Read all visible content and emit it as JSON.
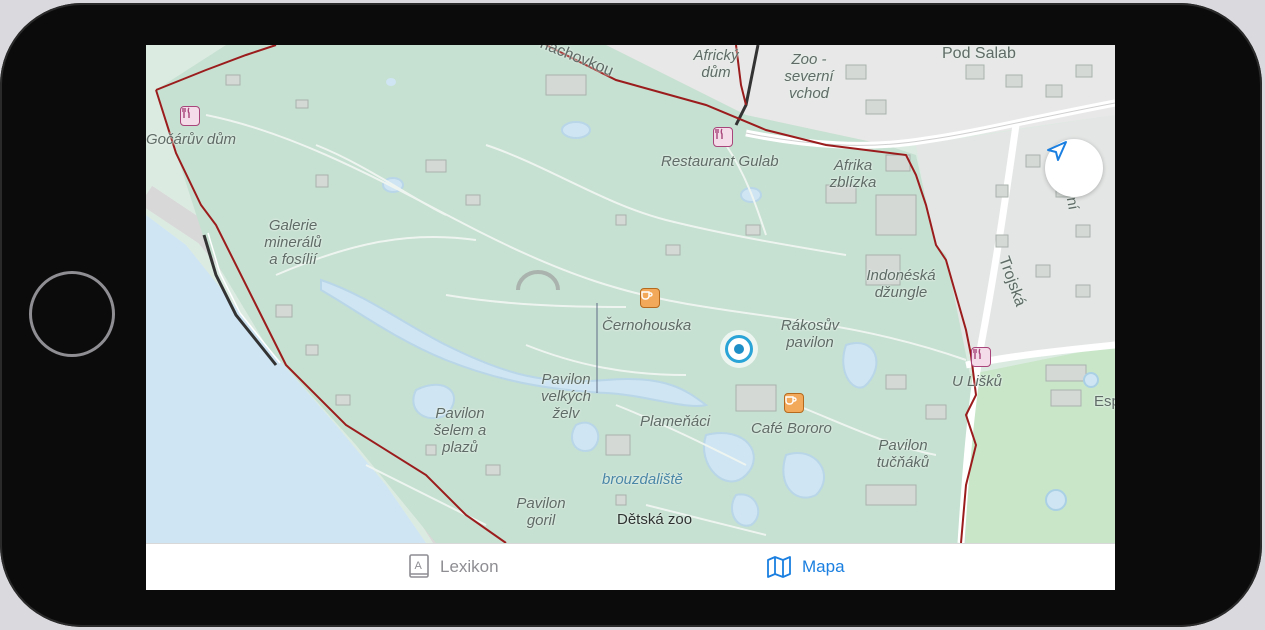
{
  "device": {
    "home_button": "home-button"
  },
  "map": {
    "labels": {
      "gocaruv_dum": "Gočárův dům",
      "galerie": "Galerie\nminerálů\na fosílií",
      "africky_dum": "Africký\ndům",
      "zoo_vchod": "Zoo -\nseverní\nvchod",
      "pod_salabkou": "Pod Salab",
      "nachovkou": "nachovkou",
      "restaurant_gulab": "Restaurant Gulab",
      "afrika_zblizka": "Afrika\nzblízka",
      "indonesian": "Indonéská\ndžungle",
      "cernohouska": "Černohouska",
      "rakosuv": "Rákosův\npavilon",
      "u_lisku": "U Lišků",
      "trojska": "Trojská",
      "ni_fragment": "ní",
      "pavilon_zelv": "Pavilon\nvelkých\nželv",
      "plamenaci": "Plameňáci",
      "cafe_bororo": "Café Bororo",
      "pavilon_selem": "Pavilon\nšelem a\nplazů",
      "pavilon_tucnaku": "Pavilon\ntučňáků",
      "brouzdaliste": "brouzdaliště",
      "pavilon_goril": "Pavilon\ngoril",
      "detska_zoo": "Dětská zoo",
      "esp_fragment": "Esp"
    },
    "icons": {
      "locate": "location-arrow-icon",
      "restaurant": "fork-knife-icon",
      "cafe": "coffee-cup-icon",
      "user_location": "user-location-icon"
    },
    "colors": {
      "park": "#c9e3d4",
      "water": "#cfe5f3",
      "boundary": "#9b1c1c",
      "accent": "#1a7fe0"
    }
  },
  "tabs": [
    {
      "label": "Lexikon",
      "icon": "book-icon",
      "selected": false
    },
    {
      "label": "Mapa",
      "icon": "map-icon",
      "selected": true
    }
  ]
}
